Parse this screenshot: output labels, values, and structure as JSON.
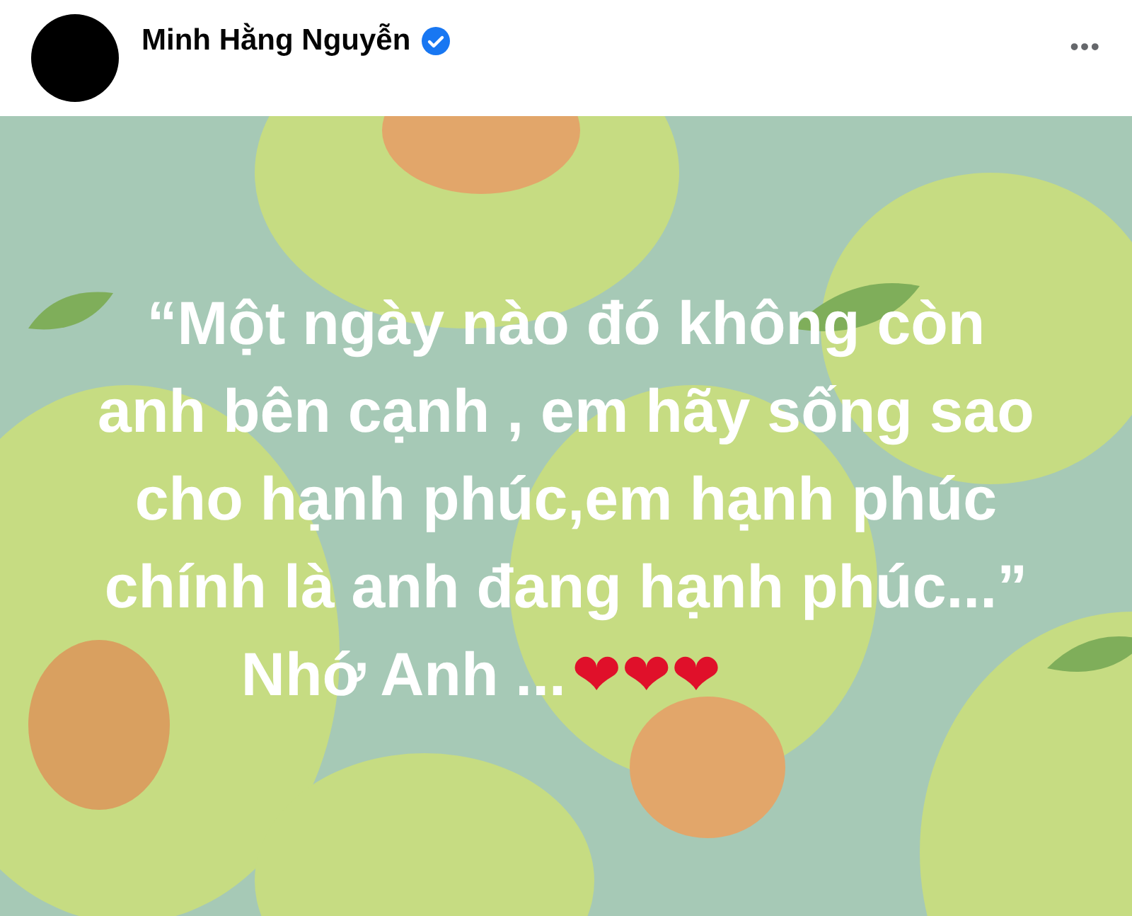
{
  "post": {
    "author": "Minh Hằng Nguyễn",
    "verified": true,
    "more": "•••"
  },
  "quote_lines": [
    "“Một ngày nào đó không còn",
    "anh bên cạnh , em hãy sống sao",
    "cho hạnh phúc,em hạnh phúc",
    "chính là anh đang hạnh phúc...”"
  ],
  "signoff": "Nhớ Anh ...",
  "hearts": "❤❤❤"
}
